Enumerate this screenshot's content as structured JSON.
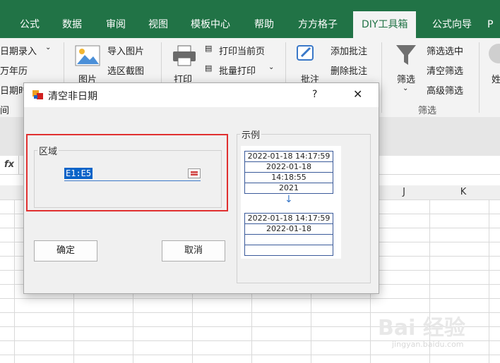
{
  "ribbon_tabs": {
    "formula": "公式",
    "data": "数据",
    "review": "审阅",
    "view": "视图",
    "template": "模板中心",
    "help": "帮助",
    "ffgz": "方方格子",
    "diy": "DIY工具箱",
    "formula_guide": "公式向导",
    "more": "P"
  },
  "ribbon": {
    "date_entry": "日期录入",
    "calendar": "万年历",
    "date_calc": "日期时",
    "time": "间",
    "image": "图片",
    "import_image": "导入图片",
    "screenshot": "选区截图",
    "print": "打印",
    "print_current": "打印当前页",
    "batch_print": "批量打印",
    "comment": "批注",
    "add_comment": "添加批注",
    "del_comment": "删除批注",
    "filter": "筛选",
    "filter_select": "筛选选中",
    "clear_filter": "清空筛选",
    "advanced_filter": "高级筛选",
    "filter_group": "筛选",
    "name_cut": "姓"
  },
  "formula_bar": {
    "fx": "fx"
  },
  "columns": {
    "j": "J",
    "k": "K"
  },
  "dialog": {
    "title": "清空非日期",
    "help": "?",
    "close": "✕",
    "area_label": "区域",
    "range_value": "E1:E5",
    "ok": "确定",
    "cancel": "取消",
    "example_label": "示例",
    "example_before": [
      "2022-01-18 14:17:59",
      "2022-01-18",
      "14:18:55",
      "2021"
    ],
    "example_after": [
      "2022-01-18 14:17:59",
      "2022-01-18",
      "",
      ""
    ],
    "arrow": "↓"
  },
  "watermark": {
    "brand": "Bai 经验",
    "url": "jingyan.baidu.com"
  },
  "colors": {
    "excel_green": "#217346",
    "highlight_red": "#e03030",
    "selection_blue": "#0a64c8"
  }
}
